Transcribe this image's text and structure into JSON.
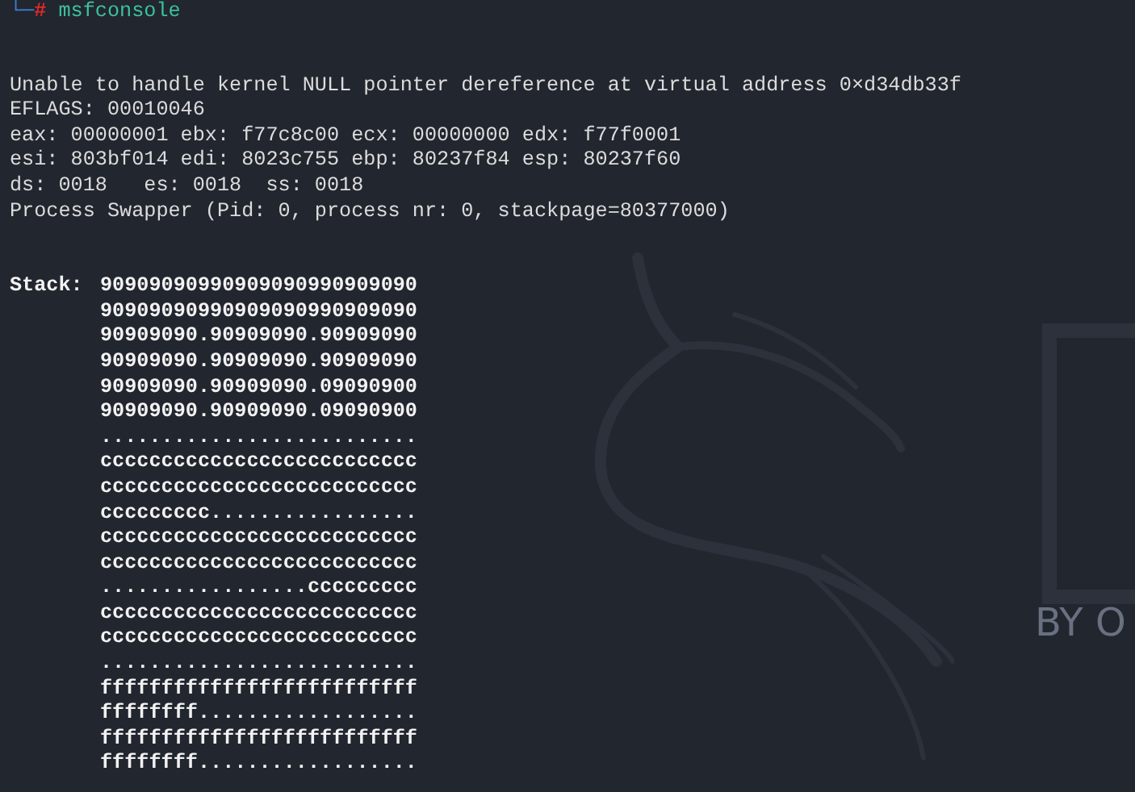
{
  "prompt": {
    "branch": "└─",
    "symbol": "#",
    "command": "msfconsole"
  },
  "output_lines": [
    "Unable to handle kernel NULL pointer dereference at virtual address 0×d34db33f",
    "EFLAGS: 00010046",
    "eax: 00000001 ebx: f77c8c00 ecx: 00000000 edx: f77f0001",
    "esi: 803bf014 edi: 8023c755 ebp: 80237f84 esp: 80237f60",
    "ds: 0018   es: 0018  ss: 0018",
    "Process Swapper (Pid: 0, process nr: 0, stackpage=80377000)"
  ],
  "stack": {
    "label": "Stack:",
    "rows": [
      "90909090990909090990909090",
      "90909090990909090990909090",
      "90909090.90909090.90909090",
      "90909090.90909090.90909090",
      "90909090.90909090.09090900",
      "90909090.90909090.09090900",
      "..........................",
      "cccccccccccccccccccccccccc",
      "cccccccccccccccccccccccccc",
      "ccccccccc.................",
      "cccccccccccccccccccccccccc",
      "cccccccccccccccccccccccccc",
      ".................ccccccccc",
      "cccccccccccccccccccccccccc",
      "cccccccccccccccccccccccccc",
      "..........................",
      "ffffffffffffffffffffffffff",
      "ffffffff..................",
      "ffffffffffffffffffffffffff",
      "ffffffff.................."
    ]
  },
  "wallpaper": {
    "logo_text": "BY O"
  }
}
